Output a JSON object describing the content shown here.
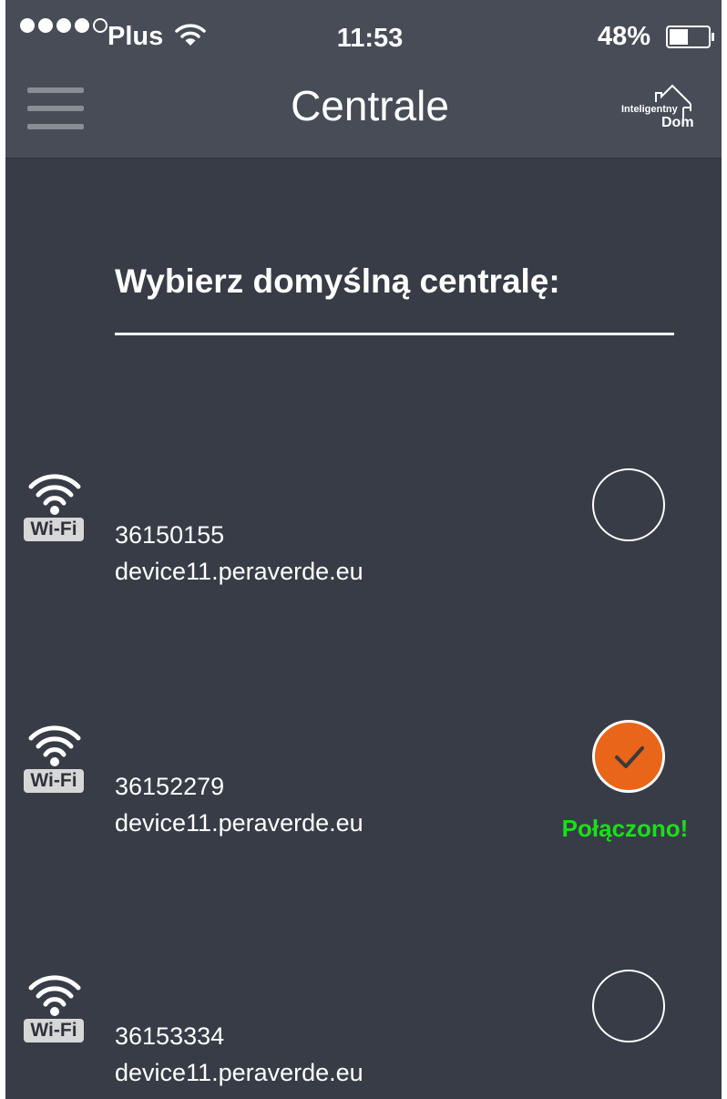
{
  "status_bar": {
    "carrier": "Plus",
    "time": "11:53",
    "battery_percent": "48%",
    "battery_level": 0.48,
    "signal_bars_filled": 4,
    "signal_bars_total": 5
  },
  "nav": {
    "title": "Centrale",
    "logo": {
      "line1": "Inteligentny",
      "line2": "Dom"
    }
  },
  "heading": "Wybierz domyślną centralę:",
  "devices": [
    {
      "badge": "Wi-Fi",
      "id": "36150155",
      "host": "device11.peraverde.eu",
      "selected": false,
      "status": ""
    },
    {
      "badge": "Wi-Fi",
      "id": "36152279",
      "host": "device11.peraverde.eu",
      "selected": true,
      "status": "Połączono!"
    },
    {
      "badge": "Wi-Fi",
      "id": "36153334",
      "host": "device11.peraverde.eu",
      "selected": false,
      "status": ""
    }
  ],
  "colors": {
    "background": "#383c47",
    "topbar": "#484c57",
    "selected_radio": "#e8651a",
    "connected_text": "#19e019"
  },
  "icons": {
    "menu": "hamburger-menu-icon",
    "wifi": "wifi-icon",
    "battery": "battery-icon",
    "check": "checkmark-icon",
    "logo": "house-logo-icon"
  }
}
